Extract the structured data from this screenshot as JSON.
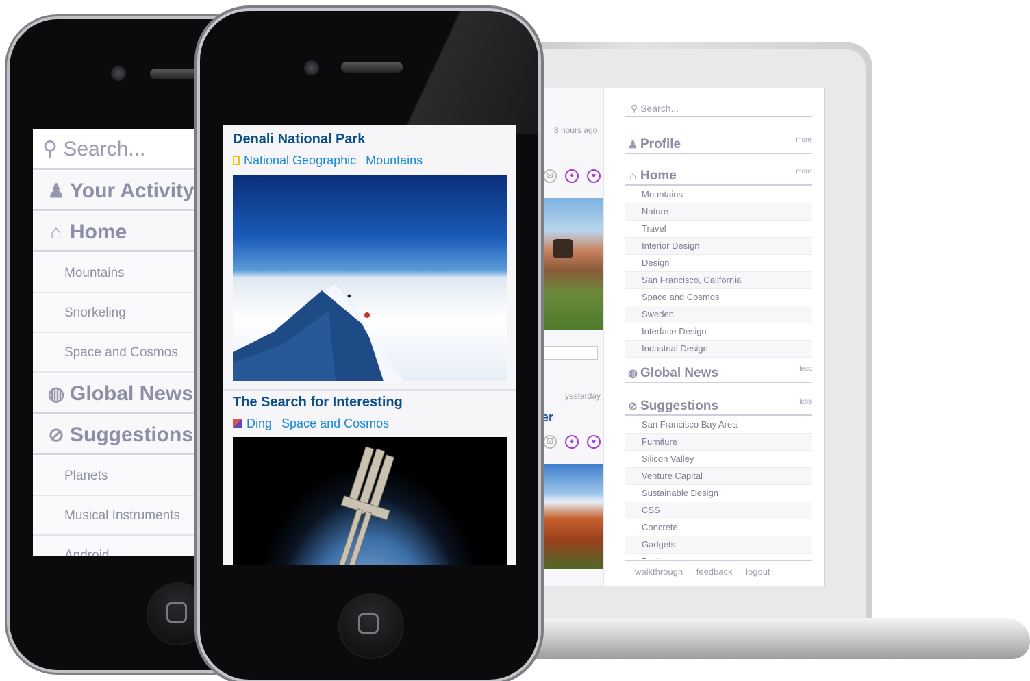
{
  "laptop": {
    "feed": {
      "time_1": "8 hours ago",
      "time_2": "yesterday",
      "partial_letter": "er",
      "actions": [
        "☒",
        "✦",
        "♥"
      ]
    },
    "sidebar": {
      "search_placeholder": "Search...",
      "profile": {
        "label": "Profile",
        "toggle": "more"
      },
      "home": {
        "label": "Home",
        "toggle": "more"
      },
      "home_items": [
        "Mountains",
        "Nature",
        "Travel",
        "Interior Design",
        "Design",
        "San Francisco, California",
        "Space and Cosmos",
        "Sweden",
        "Interface Design",
        "Industrial Design"
      ],
      "global_news": {
        "label": "Global News",
        "toggle": "less"
      },
      "suggestions": {
        "label": "Suggestions",
        "toggle": "less"
      },
      "suggestion_items": [
        "San Francisco Bay Area",
        "Furniture",
        "Silicon Valley",
        "Venture Capital",
        "Sustainable Design",
        "CSS",
        "Concrete",
        "Gadgets",
        "Business"
      ],
      "footer": [
        "walkthrough",
        "feedback",
        "logout"
      ]
    }
  },
  "back_phone": {
    "search_placeholder": "Search...",
    "your_activity": "Your Activity",
    "home": "Home",
    "home_items": [
      "Mountains",
      "Snorkeling",
      "Space and Cosmos"
    ],
    "global_news": "Global News",
    "suggestions": "Suggestions",
    "suggestion_items": [
      "Planets",
      "Musical Instruments",
      "Android"
    ]
  },
  "front_phone": {
    "cards": [
      {
        "title": "Denali National Park",
        "source": "National Geographic",
        "topic": "Mountains"
      },
      {
        "title": "The Search for Interesting",
        "source": "Ding",
        "topic": "Space and Cosmos"
      }
    ]
  },
  "colors": {
    "title_blue": "#0b4f89",
    "link_blue": "#1a8ad6",
    "sidebar_text": "#8d8fa6",
    "accent_purple": "#a23cd6"
  }
}
